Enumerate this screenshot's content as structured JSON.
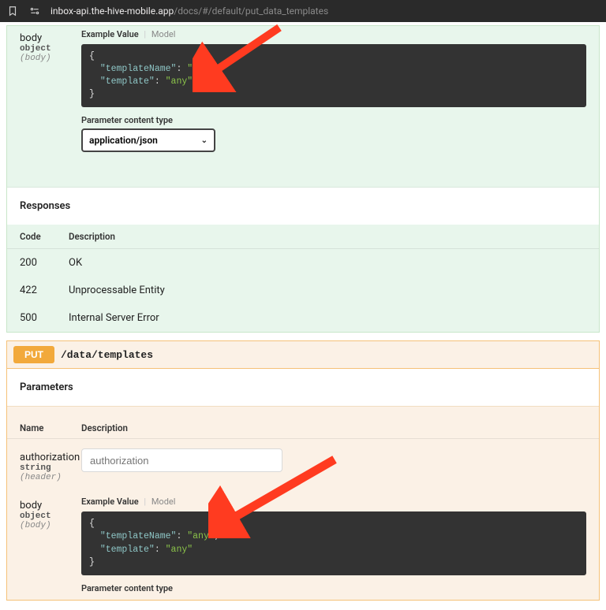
{
  "browser": {
    "url_host": "inbox-api.the-hive-mobile.app",
    "url_path": "/docs/#/default/put_data_templates"
  },
  "op1": {
    "param": {
      "name": "body",
      "type": "object",
      "loc": "(body)"
    },
    "tabs": {
      "example": "Example Value",
      "model": "Model"
    },
    "code": {
      "open": "{",
      "k1": "\"templateName\"",
      "c1": ": ",
      "v1": "\"any\"",
      "comma": ",",
      "k2": "\"template\"",
      "c2": ": ",
      "v2": "\"any\"",
      "close": "}"
    },
    "ct_label": "Parameter content type",
    "ct_value": "application/json",
    "responses_title": "Responses",
    "resp_head": {
      "code": "Code",
      "desc": "Description"
    },
    "responses": [
      {
        "code": "200",
        "desc": "OK"
      },
      {
        "code": "422",
        "desc": "Unprocessable Entity"
      },
      {
        "code": "500",
        "desc": "Internal Server Error"
      }
    ]
  },
  "op2": {
    "method": "PUT",
    "path": "/data/templates",
    "parameters_title": "Parameters",
    "params_head": {
      "name": "Name",
      "desc": "Description"
    },
    "auth": {
      "name": "authorization",
      "type": "string",
      "loc": "(header)",
      "placeholder": "authorization"
    },
    "body": {
      "name": "body",
      "type": "object",
      "loc": "(body)"
    },
    "tabs": {
      "example": "Example Value",
      "model": "Model"
    },
    "code": {
      "open": "{",
      "k1": "\"templateName\"",
      "c1": ": ",
      "v1": "\"any\"",
      "comma": ",",
      "k2": "\"template\"",
      "c2": ": ",
      "v2": "\"any\"",
      "close": "}"
    },
    "ct_label": "Parameter content type"
  }
}
